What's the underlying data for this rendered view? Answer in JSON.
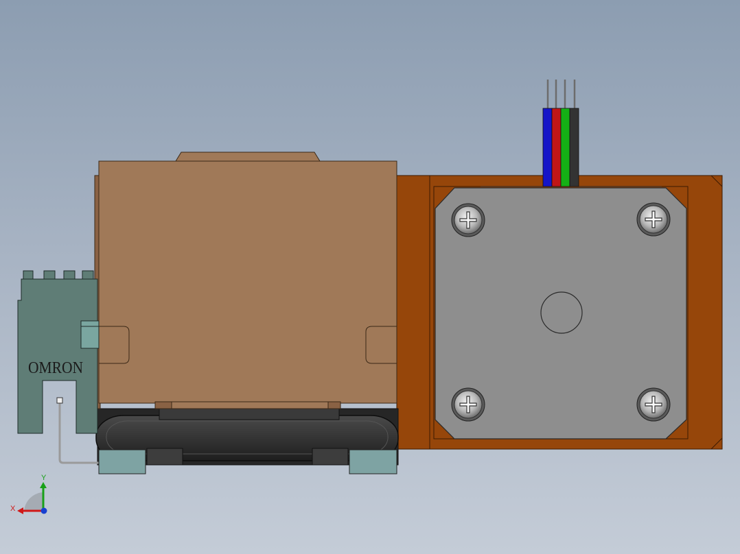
{
  "viewport": {
    "background_top": "#8c9db1",
    "background_bottom": "#c4ccd7"
  },
  "sensor": {
    "brand_label": "OMRON",
    "color": "#5f7d76"
  },
  "pulley_housing": {
    "color": "#a07958"
  },
  "base_plate": {
    "color": "#96460a"
  },
  "stepper_motor": {
    "face_color": "#8e8e8e",
    "screw_icon": "phillips-screw-icon",
    "screw_count": 4
  },
  "motor_cable": {
    "wire_colors": [
      "#1515c8",
      "#c01616",
      "#15b015",
      "#333333"
    ]
  },
  "belt": {
    "color": "#2a2a2a"
  },
  "feet": {
    "color": "#7ea3a3"
  },
  "triad": {
    "x_label": "X",
    "y_label": "Y",
    "x_color": "#d01818",
    "y_color": "#18a018",
    "z_color": "#1840d0"
  }
}
